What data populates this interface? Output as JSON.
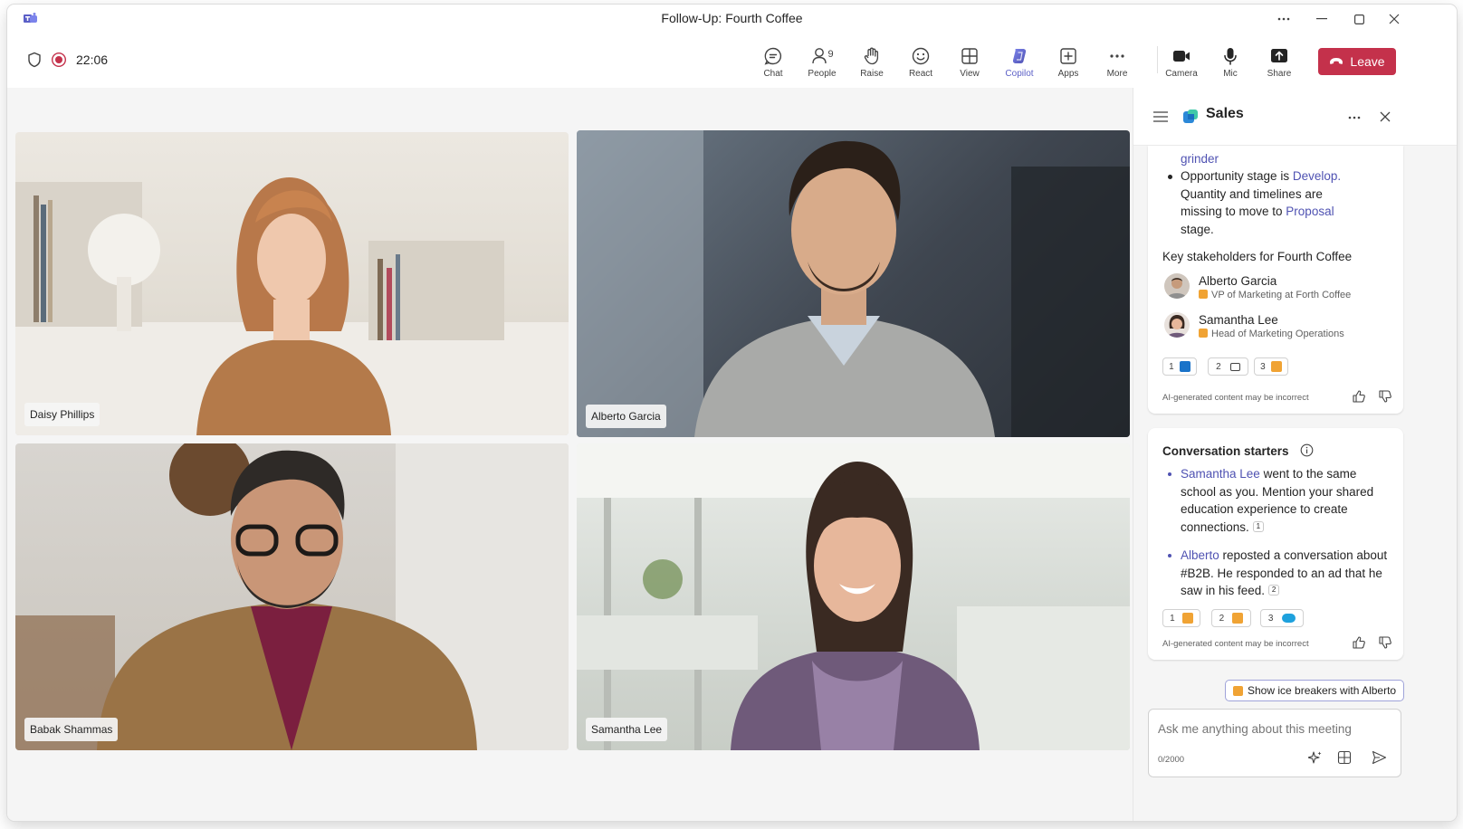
{
  "window": {
    "title": "Follow-Up: Fourth Coffee",
    "controls": [
      "more-icon",
      "minimize-icon",
      "maximize-icon",
      "close-icon"
    ]
  },
  "toolbar": {
    "timer": "22:06",
    "items": [
      {
        "label": "Chat",
        "icon": "chat-icon"
      },
      {
        "label": "People",
        "icon": "people-icon",
        "count": "9"
      },
      {
        "label": "Raise",
        "icon": "hand-icon"
      },
      {
        "label": "React",
        "icon": "smile-icon"
      },
      {
        "label": "View",
        "icon": "grid-icon"
      },
      {
        "label": "Copilot",
        "icon": "copilot-icon",
        "active": true
      },
      {
        "label": "Apps",
        "icon": "add-app-icon"
      },
      {
        "label": "More",
        "icon": "more-icon"
      },
      {
        "label": "Camera",
        "icon": "camera-icon"
      },
      {
        "label": "Mic",
        "icon": "mic-icon"
      },
      {
        "label": "Share",
        "icon": "share-icon"
      }
    ],
    "leave_label": "Leave",
    "accent": "#5b5fc7",
    "leave_color": "#c4314b"
  },
  "participants": [
    {
      "name": "Daisy Phillips"
    },
    {
      "name": "Alberto Garcia"
    },
    {
      "name": "Babak Shammas"
    },
    {
      "name": "Samantha Lee"
    }
  ],
  "panel": {
    "title": "Sales",
    "card1": {
      "partial_link": "grinder",
      "bullet_prefix": "Opportunity stage is ",
      "bullet_link1": "Develop.",
      "bullet_mid": " Quantity and timelines are missing to move to ",
      "bullet_link2": "Proposal",
      "bullet_suffix": " stage.",
      "stakeholders_heading": "Key stakeholders for Fourth Coffee",
      "stakeholders": [
        {
          "name": "Alberto Garcia",
          "role": "VP of Marketing at Forth Coffee"
        },
        {
          "name": "Samantha Lee",
          "role": "Head of Marketing Operations"
        }
      ],
      "refs": [
        "1",
        "2",
        "3"
      ],
      "disclaimer": "AI-generated content may be incorrect"
    },
    "card2": {
      "heading": "Conversation starters",
      "items": [
        {
          "link": "Samantha Lee",
          "text": " went to the same school as you. Mention your shared education experience to create connections.",
          "ref": "1"
        },
        {
          "link": "Alberto",
          "text": " reposted a conversation about #B2B. He responded to an ad that he saw in his feed.",
          "ref": "2"
        }
      ],
      "refs": [
        "1",
        "2",
        "3"
      ],
      "disclaimer": "AI-generated content may be incorrect"
    },
    "suggestion": "Show ice breakers with Alberto",
    "input": {
      "placeholder": "Ask me anything about this meeting",
      "counter": "0/2000"
    }
  }
}
